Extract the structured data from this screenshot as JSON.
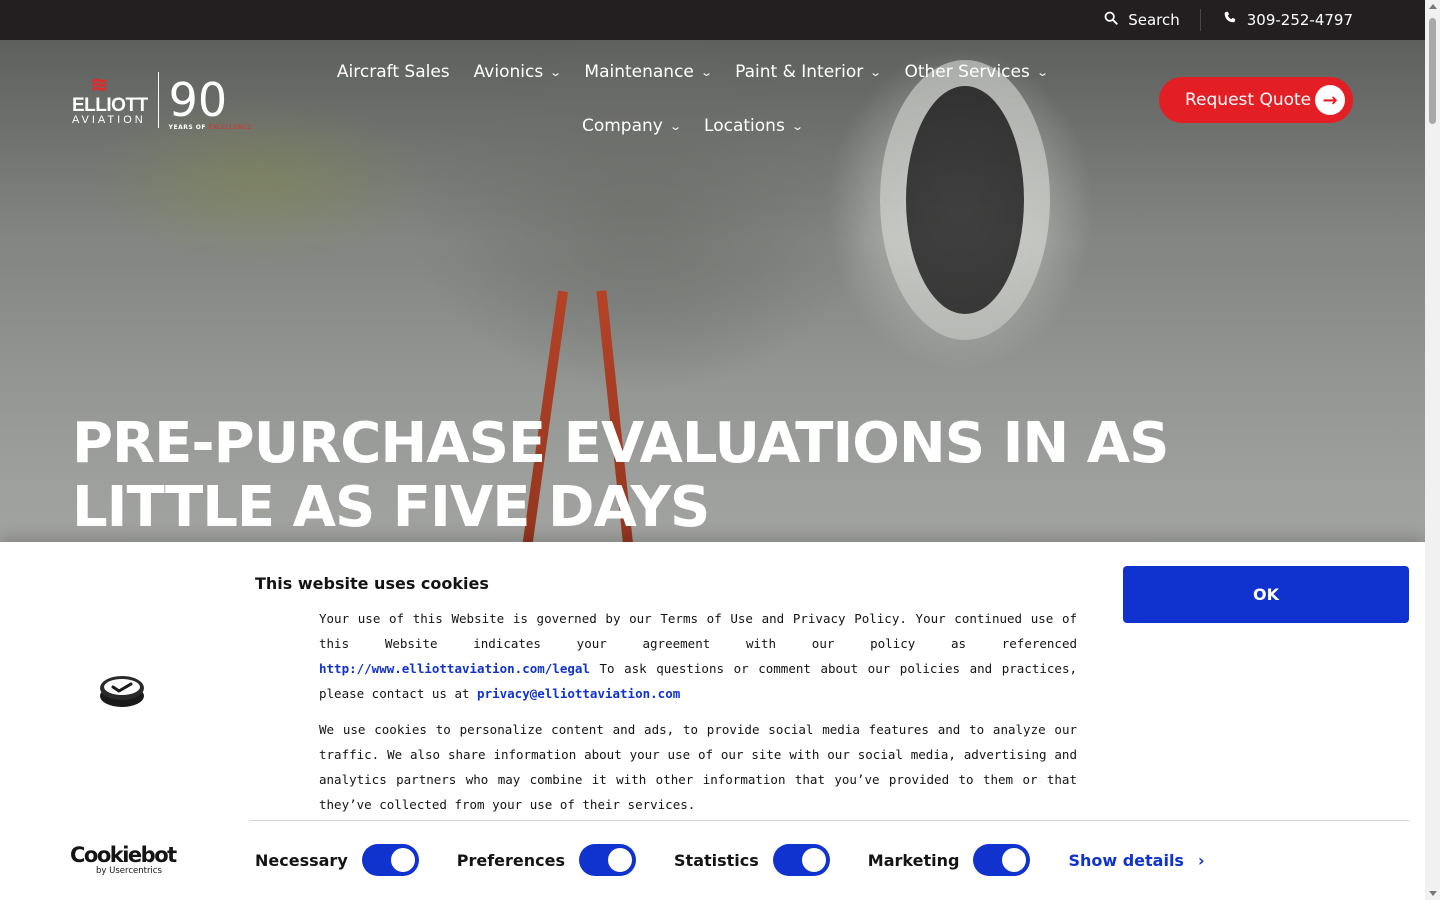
{
  "topbar": {
    "search_label": "Search",
    "phone": "309-252-4797"
  },
  "logo": {
    "brand": "ELLIOTT",
    "brand_sub": "AVIATION",
    "anniversary": "90",
    "tagline_prefix": "YEARS OF",
    "tagline_highlight": "EXCELLENCE"
  },
  "nav": {
    "items": [
      {
        "label": "Aircraft Sales"
      },
      {
        "label": "Avionics"
      },
      {
        "label": "Maintenance"
      },
      {
        "label": "Paint & Interior"
      },
      {
        "label": "Other Services"
      },
      {
        "label": "Company"
      },
      {
        "label": "Locations"
      }
    ],
    "quote_button": "Request Quote"
  },
  "hero": {
    "title": "PRE-PURCHASE EVALUATIONS IN AS LITTLE AS FIVE DAYS"
  },
  "cookie": {
    "title": "This website uses cookies",
    "p1_start": "Your use of this Website is governed by our Terms of Use and Privacy Policy.  Your continued use of this Website indicates your agreement with our policy as referenced ",
    "p1_link": "http://www.elliottaviation.com/legal",
    "p1_mid": "  To ask questions or comment about our policies and practices, please contact us at ",
    "p1_email": "privacy@elliottaviation.com",
    "p2": "We use cookies to personalize content and ads, to provide social media features and to analyze our traffic. We also share information about your use of our site with our social media, advertising and analytics partners who may combine it with other information that you’ve provided to them or that they’ve collected from your use of their services.",
    "ok_button": "OK",
    "toggles": [
      {
        "label": "Necessary",
        "on": true
      },
      {
        "label": "Preferences",
        "on": true
      },
      {
        "label": "Statistics",
        "on": true
      },
      {
        "label": "Marketing",
        "on": true
      }
    ],
    "show_details": "Show details",
    "brand": "Cookiebot",
    "brand_sub": "by Usercentrics"
  },
  "colors": {
    "accent_red": "#e31e24",
    "cookie_blue": "#1032cf",
    "topbar_bg": "#231f20"
  }
}
